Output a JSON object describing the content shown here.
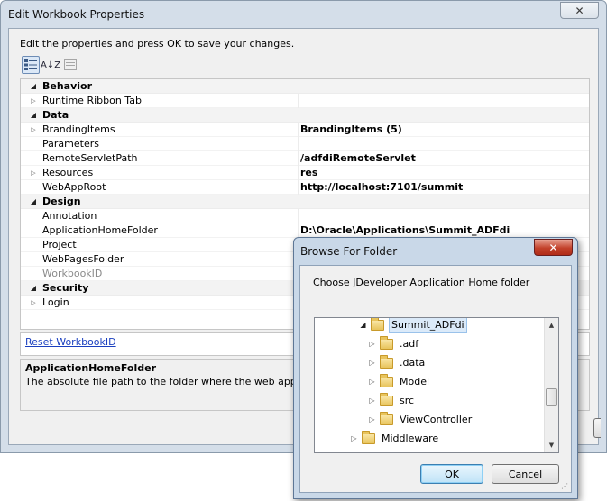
{
  "main_window": {
    "title": "Edit Workbook Properties",
    "close_glyph": "✕",
    "instruction": "Edit the properties and press OK to save your changes.",
    "toolbar": {
      "categorized_icon": "categorized-icon",
      "alphabetical_label": "A↓Z",
      "pages_icon": "property-pages-icon"
    },
    "grid": {
      "categories": [
        {
          "name": "Behavior",
          "rows": [
            {
              "name": "Runtime Ribbon Tab",
              "value": "",
              "expandable": true
            }
          ]
        },
        {
          "name": "Data",
          "rows": [
            {
              "name": "BrandingItems",
              "value": "BrandingItems (5)",
              "expandable": true
            },
            {
              "name": "Parameters",
              "value": "",
              "expandable": false
            },
            {
              "name": "RemoteServletPath",
              "value": "/adfdiRemoteServlet",
              "expandable": false
            },
            {
              "name": "Resources",
              "value": "res",
              "expandable": true
            },
            {
              "name": "WebAppRoot",
              "value": "http://localhost:7101/summit",
              "expandable": false
            }
          ]
        },
        {
          "name": "Design",
          "rows": [
            {
              "name": "Annotation",
              "value": "",
              "expandable": false
            },
            {
              "name": "ApplicationHomeFolder",
              "value": "D:\\Oracle\\Applications\\Summit_ADFdi",
              "expandable": false
            },
            {
              "name": "Project",
              "value": "",
              "expandable": false
            },
            {
              "name": "WebPagesFolder",
              "value": "",
              "expandable": false
            },
            {
              "name": "WorkbookID",
              "value": "",
              "expandable": false,
              "disabled": true
            }
          ]
        },
        {
          "name": "Security",
          "rows": [
            {
              "name": "Login",
              "value": "",
              "expandable": true
            }
          ]
        }
      ]
    },
    "reset_link": "Reset WorkbookID",
    "description": {
      "title": "ApplicationHomeFolder",
      "text": "The absolute file path to the folder where the web application"
    }
  },
  "browse_dialog": {
    "title": "Browse For Folder",
    "close_glyph": "✕",
    "description": "Choose JDeveloper Application Home folder",
    "tree": [
      {
        "label": "Summit_ADFdi",
        "level": 0,
        "expanded": true,
        "selected": true
      },
      {
        "label": ".adf",
        "level": 1,
        "expanded": false
      },
      {
        "label": ".data",
        "level": 1,
        "expanded": false
      },
      {
        "label": "Model",
        "level": 1,
        "expanded": false
      },
      {
        "label": "src",
        "level": 1,
        "expanded": false
      },
      {
        "label": "ViewController",
        "level": 1,
        "expanded": false
      },
      {
        "label": "Middleware",
        "level": -1,
        "expanded": false
      }
    ],
    "ok_label": "OK",
    "cancel_label": "Cancel"
  },
  "colors": {
    "window_frame": "#d4dee9",
    "dialog_frame": "#c9d8e8",
    "link": "#1a3fbf",
    "close_red": "#c2412a",
    "selection": "#dbeaf9"
  }
}
